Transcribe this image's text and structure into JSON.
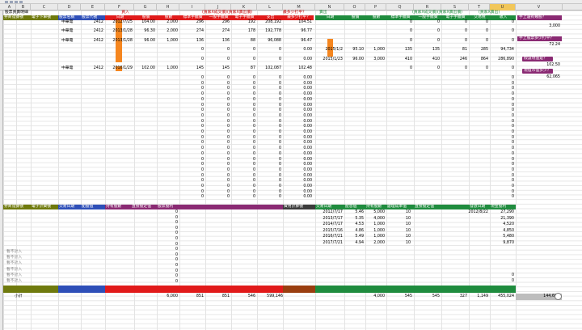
{
  "header": {
    "sheet_title": "股票買賣明細",
    "buy_section": "買入",
    "sell_section": "賣出",
    "buy_fee_note": "(買家X成交價)(買家X賣出價)",
    "buy_breakeven": "最多少打平？",
    "sell_fee_note": "(買家X成交價)(買家X賣出價)",
    "sell_breakeven": "(買家X賣出)"
  },
  "col_letters": [
    "A",
    "B",
    "C",
    "D",
    "E",
    "F",
    "G",
    "H",
    "I",
    "J",
    "K",
    "L",
    "M",
    "N",
    "O",
    "P",
    "Q",
    "R",
    "S",
    "T",
    "U",
    "V"
  ],
  "selected_col": "U",
  "top_headers": {
    "a": "券商證據號",
    "b": "電子下單號",
    "c": "股票名稱",
    "d": "股票代號",
    "e": "日期",
    "f": "股價",
    "g": "股數",
    "h": "標準手續費",
    "i": "一般手續費",
    "j": "電子手續費",
    "k": "支出",
    "l": "最多少打平？",
    "m": "日期",
    "n": "股價",
    "o": "股數",
    "p": "標準手續費",
    "q": "一般手續費",
    "r": "電子手續費",
    "s": "交易稅",
    "t": "收入"
  },
  "buy_rows": [
    {
      "name": "中華電",
      "code": "2412",
      "date": "2012/7/25",
      "price": "104.00",
      "shares": "2,000",
      "std": "296",
      "gen": "296",
      "elec": "192",
      "cost": "208,192",
      "breakeven": "104.51"
    },
    {
      "name": "中華電",
      "code": "2412",
      "date": "2013/1/28",
      "price": "96.30",
      "shares": "2,000",
      "std": "274",
      "gen": "274",
      "elec": "178",
      "cost": "192,778",
      "breakeven": "96.77"
    },
    {
      "name": "中華電",
      "code": "2412",
      "date": "2013/1/28",
      "price": "96.00",
      "shares": "1,000",
      "std": "136",
      "gen": "136",
      "elec": "88",
      "cost": "96,088",
      "breakeven": "96.47"
    },
    {
      "name": "",
      "code": "",
      "date": "",
      "price": "",
      "shares": "",
      "std": "0",
      "gen": "0",
      "elec": "0",
      "cost": "0",
      "breakeven": "0.00"
    },
    {
      "name": "",
      "code": "",
      "date": "",
      "price": "",
      "shares": "",
      "std": "0",
      "gen": "0",
      "elec": "0",
      "cost": "0",
      "breakeven": "0.00"
    },
    {
      "name": "中華電",
      "code": "2412",
      "date": "2016/1/29",
      "price": "102.00",
      "shares": "1,000",
      "std": "145",
      "gen": "145",
      "elec": "87",
      "cost": "102,087",
      "breakeven": "102.48"
    }
  ],
  "sell_rows": [
    {
      "date": "",
      "price": "",
      "shares": "",
      "std": "0",
      "gen": "0",
      "elec": "0",
      "tax": "0",
      "income": "0"
    },
    {
      "date": "",
      "price": "",
      "shares": "",
      "std": "0",
      "gen": "0",
      "elec": "0",
      "tax": "0",
      "income": "0"
    },
    {
      "date": "",
      "price": "",
      "shares": "",
      "std": "0",
      "gen": "0",
      "elec": "0",
      "tax": "0",
      "income": "0"
    },
    {
      "date": "2015/1/2",
      "price": "95.10",
      "shares": "1,000",
      "std": "135",
      "gen": "135",
      "elec": "81",
      "tax": "285",
      "income": "94,734"
    },
    {
      "date": "2015/1/23",
      "price": "96.00",
      "shares": "3,000",
      "std": "410",
      "gen": "410",
      "elec": "246",
      "tax": "864",
      "income": "286,890"
    },
    {
      "date": "",
      "price": "",
      "shares": "",
      "std": "0",
      "gen": "0",
      "elec": "0",
      "tax": "0",
      "income": "0"
    }
  ],
  "side_panel": {
    "label1": "手上還有幾股？",
    "value1": "3,000",
    "label2": "手上股票多少打平？",
    "value2": "72.24",
    "label3": "假設現值是？",
    "value3": "102.50",
    "label4": "現值市值多少？",
    "value4": "62,065"
  },
  "zero_rows_count": 23,
  "zero_value": "0",
  "zero_pct": "0.00",
  "bottom_headers": {
    "a": "券商證據號",
    "b": "電子計費號",
    "c": "交易日期",
    "d": "配股值",
    "e": "持有股數",
    "f": "直接股定值",
    "g": "股票股利",
    "l": "費用計算號",
    "m": "交易日期",
    "n": "配息值",
    "o": "持有股數",
    "p": "處理成本值",
    "q": "直接股定值",
    "s": "發放日期",
    "t": "現金股利"
  },
  "dividend_rows": [
    {
      "date": "2012/7/17",
      "rate": "5.46",
      "shares": "5,000",
      "units": "10",
      "paydate": "2012/8/22",
      "cash": "27,290"
    },
    {
      "date": "2013/7/17",
      "rate": "5.35",
      "shares": "4,000",
      "units": "10",
      "paydate": "",
      "cash": "21,390"
    },
    {
      "date": "2014/7/17",
      "rate": "4.53",
      "shares": "1,000",
      "units": "10",
      "paydate": "",
      "cash": "4,520"
    },
    {
      "date": "2015/7/16",
      "rate": "4.86",
      "shares": "1,000",
      "units": "10",
      "paydate": "",
      "cash": "4,850"
    },
    {
      "date": "2016/7/21",
      "rate": "5.49",
      "shares": "1,000",
      "units": "10",
      "paydate": "",
      "cash": "5,480"
    },
    {
      "date": "2017/7/21",
      "rate": "4.94",
      "shares": "2,000",
      "units": "10",
      "paydate": "",
      "cash": "9,870"
    }
  ],
  "no_count_label": "暫不計入",
  "no_count_rows": 6,
  "totals": {
    "label": "小計",
    "shares": "6,000",
    "std": "851",
    "gen": "851",
    "elec": "546",
    "cost": "599,146",
    "sell_shares": "4,000",
    "sell_std": "545",
    "sell_gen": "545",
    "sell_elec": "327",
    "sell_tax": "1,149",
    "sell_income": "455,024",
    "grand": "144,690"
  }
}
